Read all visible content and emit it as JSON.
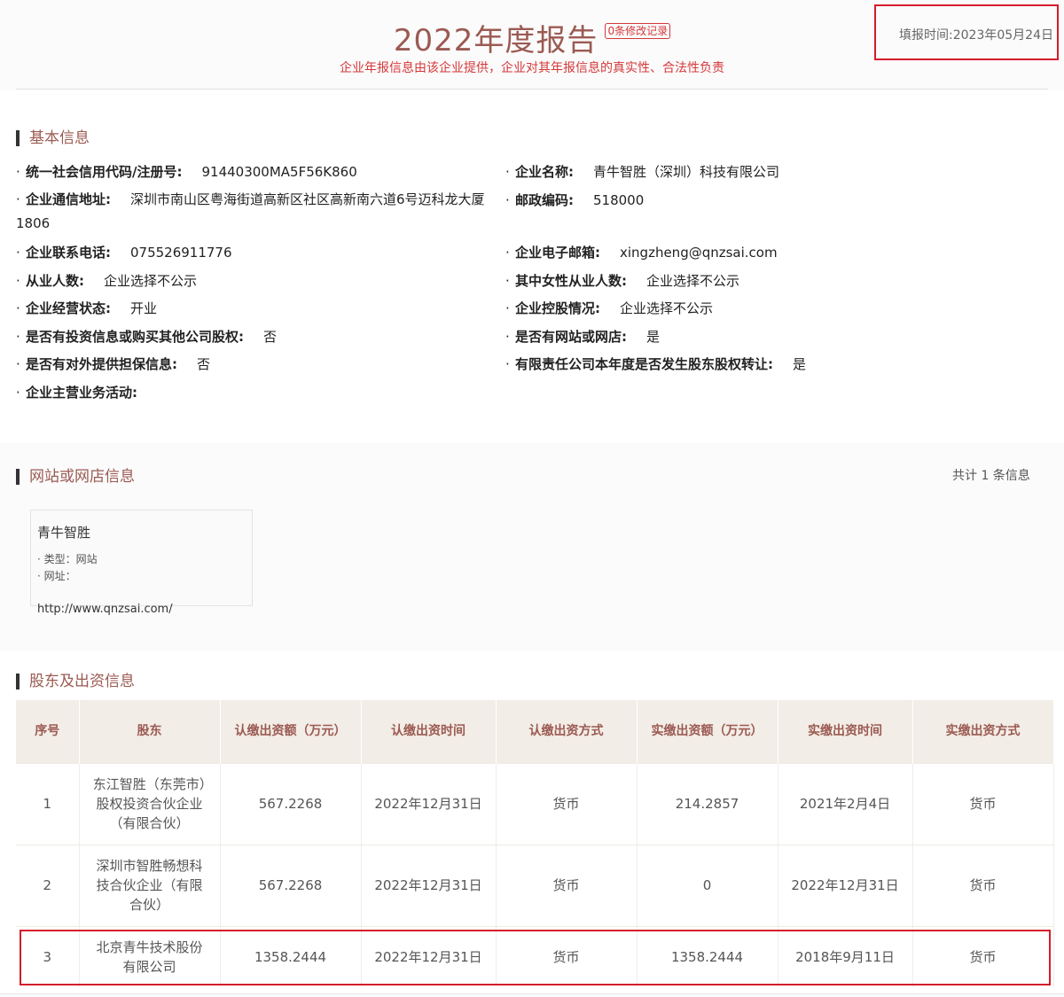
{
  "header": {
    "title": "2022年度报告",
    "modification_link": "0条修改记录",
    "subtitle": "企业年报信息由该企业提供，企业对其年报信息的真实性、合法性负责",
    "fill_time": "填报时间:2023年05月24日"
  },
  "basic_info": {
    "section_title": "基本信息",
    "fields": [
      {
        "label": "统一社会信用代码/注册号:",
        "value": "91440300MA5F56K860"
      },
      {
        "label": "企业名称:",
        "value": "青牛智胜（深圳）科技有限公司"
      },
      {
        "label": "企业通信地址:",
        "value": "深圳市南山区粤海街道高新区社区高新南六道6号迈科龙大厦1806"
      },
      {
        "label": "邮政编码:",
        "value": "518000"
      },
      {
        "label": "企业联系电话:",
        "value": "075526911776"
      },
      {
        "label": "企业电子邮箱:",
        "value": "xingzheng@qnzsai.com"
      },
      {
        "label": "从业人数:",
        "value": "企业选择不公示"
      },
      {
        "label": "其中女性从业人数:",
        "value": "企业选择不公示"
      },
      {
        "label": "企业经营状态:",
        "value": "开业"
      },
      {
        "label": "企业控股情况:",
        "value": "企业选择不公示"
      },
      {
        "label": "是否有投资信息或购买其他公司股权:",
        "value": "否"
      },
      {
        "label": "是否有网站或网店:",
        "value": "是"
      },
      {
        "label": "是否有对外提供担保信息:",
        "value": "否"
      },
      {
        "label": "有限责任公司本年度是否发生股东股权转让:",
        "value": "是"
      },
      {
        "label": "企业主营业务活动:",
        "value": ""
      }
    ]
  },
  "website_info": {
    "section_title": "网站或网店信息",
    "count_text": "共计 1 条信息",
    "card": {
      "name": "青牛智胜",
      "type_line": "· 类型：网站",
      "url_label": "· 网址：",
      "url": "http://www.qnzsai.com/"
    }
  },
  "shareholders": {
    "section_title": "股东及出资信息",
    "columns": [
      "序号",
      "股东",
      "认缴出资额（万元）",
      "认缴出资时间",
      "认缴出资方式",
      "实缴出资额（万元）",
      "实缴出资时间",
      "实缴出资方式"
    ],
    "rows": [
      [
        "1",
        "东江智胜（东莞市）股权投资合伙企业（有限合伙）",
        "567.2268",
        "2022年12月31日",
        "货币",
        "214.2857",
        "2021年2月4日",
        "货币"
      ],
      [
        "2",
        "深圳市智胜畅想科技合伙企业（有限合伙）",
        "567.2268",
        "2022年12月31日",
        "货币",
        "0",
        "2022年12月31日",
        "货币"
      ],
      [
        "3",
        "北京青牛技术股份有限公司",
        "1358.2444",
        "2022年12月31日",
        "货币",
        "1358.2444",
        "2018年9月11日",
        "货币"
      ]
    ]
  }
}
